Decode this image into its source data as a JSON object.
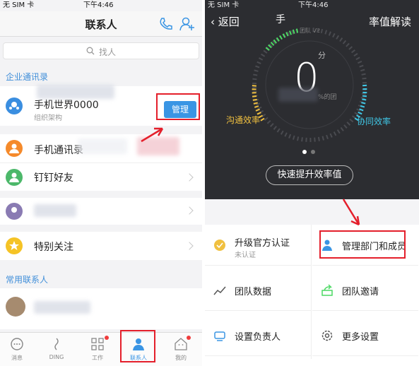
{
  "left": {
    "status": {
      "carrier": "无 SIM 卡 ",
      "time": "下午4:46"
    },
    "title": "联系人",
    "search_placeholder": "找人",
    "section_enterprise": "企业通讯录",
    "org_name": "手机世界0000",
    "org_sub": "组织架构",
    "manage_label": "管理",
    "rows": {
      "phone_contacts": "手机通讯录",
      "ding_friends": "钉钉好友",
      "special_follow": "特别关注"
    },
    "section_frequent": "常用联系人",
    "tabs": [
      "消息",
      "DING",
      "工作",
      "联系人",
      "我的"
    ],
    "colors": {
      "accent": "#3a95e4",
      "red": "#e41f2b"
    }
  },
  "right": {
    "status": {
      "carrier": "无 SIM 卡 ",
      "time": "下午4:46"
    },
    "back": "返回",
    "title_left": "手",
    "title_right": "率值解读",
    "team_v2": "团队 V2",
    "gauge": {
      "unit": "分",
      "value": "0",
      "caption": "%的团",
      "score": 0
    },
    "label_comm": "沟通效率",
    "label_collab": "协同效率",
    "boost_label": "快速提升效率值",
    "grid": {
      "certify_title": "升级官方认证",
      "certify_sub": "未认证",
      "manage_dept": "管理部门和成员",
      "team_data": "团队数据",
      "team_invite": "团队邀请",
      "set_owner": "设置负责人",
      "more_settings": "更多设置"
    },
    "colors": {
      "comm": "#f0c040",
      "collab": "#40c7e6",
      "green": "#4cd964"
    }
  }
}
